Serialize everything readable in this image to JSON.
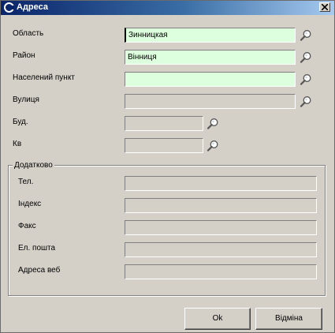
{
  "window": {
    "title": "Адреса",
    "icon": "c-app-icon",
    "close": "close-icon"
  },
  "fields": {
    "oblast": {
      "label": "Область",
      "value": "Зинницкая"
    },
    "raion": {
      "label": "Район",
      "value": "Вінниця"
    },
    "settlement": {
      "label": "Населений пункт",
      "value": ""
    },
    "street": {
      "label": "Вулиця",
      "value": ""
    },
    "building": {
      "label": "Буд.",
      "value": ""
    },
    "apartment": {
      "label": "Кв",
      "value": ""
    }
  },
  "additional": {
    "title": "Додатково",
    "phone": {
      "label": "Тел.",
      "value": ""
    },
    "index": {
      "label": "Індекс",
      "value": ""
    },
    "fax": {
      "label": "Факс",
      "value": ""
    },
    "email": {
      "label": "Ел. пошта",
      "value": ""
    },
    "web": {
      "label": "Адреса веб",
      "value": ""
    }
  },
  "buttons": {
    "ok": "Ok",
    "cancel": "Відміна"
  },
  "colors": {
    "active_field": "#ddffdd",
    "titlebar": "#0a246a",
    "face": "#d4d0c8"
  }
}
